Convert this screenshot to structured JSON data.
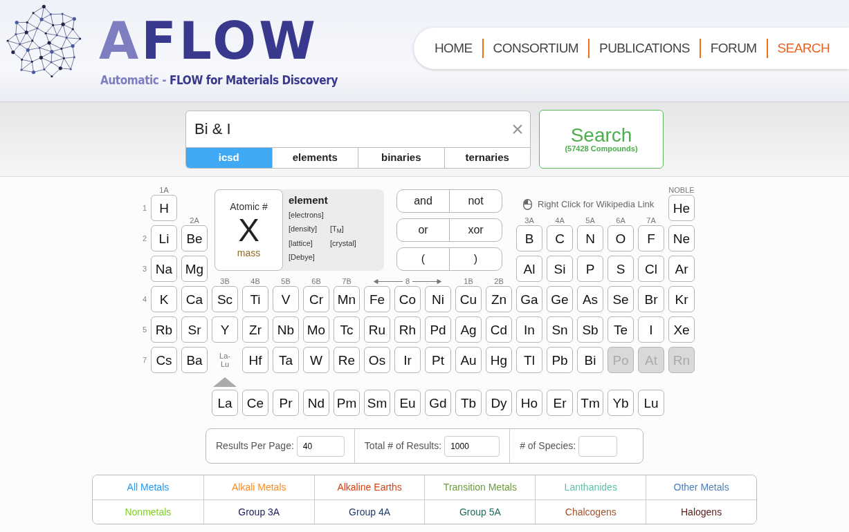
{
  "header": {
    "logo": "AFLOW",
    "tagline_prefix": "Automatic -",
    "tagline": "FLOW for Materials Discovery",
    "nav": [
      {
        "label": "HOME",
        "selected": false
      },
      {
        "label": "CONSORTIUM",
        "selected": false
      },
      {
        "label": "PUBLICATIONS",
        "selected": false
      },
      {
        "label": "FORUM",
        "selected": false
      },
      {
        "label": "SEARCH",
        "selected": true
      }
    ]
  },
  "search": {
    "value": "Bi & I",
    "tabs": [
      {
        "label": "icsd",
        "selected": true
      },
      {
        "label": "elements",
        "selected": false
      },
      {
        "label": "binaries",
        "selected": false
      },
      {
        "label": "ternaries",
        "selected": false
      }
    ],
    "button": "Search",
    "count": "(57428 Compounds)"
  },
  "legend": {
    "atomic_number": "Atomic #",
    "symbol": "X",
    "mass": "mass",
    "name": "element",
    "properties": [
      "[electrons]",
      "[density]",
      "[T$_{M}$]",
      "[lattice]",
      "[crystal]",
      "[Debye]"
    ]
  },
  "operators": [
    [
      "and",
      "not"
    ],
    [
      "or",
      "xor"
    ],
    [
      "(",
      ")"
    ]
  ],
  "hint": "Right Click for Wikipedia Link",
  "periods": [
    {
      "label": "1",
      "cells": [
        {
          "kind": "element",
          "symbol": "H",
          "group": "1A",
          "disabled": false
        },
        {
          "kind": "blank"
        },
        {
          "kind": "blank"
        },
        {
          "kind": "blank"
        },
        {
          "kind": "blank"
        },
        {
          "kind": "blank"
        },
        {
          "kind": "blank"
        },
        {
          "kind": "blank"
        },
        {
          "kind": "blank"
        },
        {
          "kind": "blank"
        },
        {
          "kind": "blank"
        },
        {
          "kind": "blank"
        },
        {
          "kind": "blank"
        },
        {
          "kind": "blank"
        },
        {
          "kind": "blank"
        },
        {
          "kind": "blank"
        },
        {
          "kind": "blank"
        },
        {
          "kind": "element",
          "symbol": "He",
          "group": "NOBLE",
          "disabled": false
        }
      ]
    },
    {
      "label": "2",
      "cells": [
        {
          "kind": "element",
          "symbol": "Li",
          "disabled": false
        },
        {
          "kind": "element",
          "symbol": "Be",
          "group": "2A",
          "disabled": false
        },
        {
          "kind": "blank"
        },
        {
          "kind": "blank"
        },
        {
          "kind": "blank"
        },
        {
          "kind": "blank"
        },
        {
          "kind": "blank"
        },
        {
          "kind": "blank"
        },
        {
          "kind": "blank"
        },
        {
          "kind": "blank"
        },
        {
          "kind": "blank"
        },
        {
          "kind": "blank"
        },
        {
          "kind": "element",
          "symbol": "B",
          "group": "3A",
          "disabled": false
        },
        {
          "kind": "element",
          "symbol": "C",
          "group": "4A",
          "disabled": false
        },
        {
          "kind": "element",
          "symbol": "N",
          "group": "5A",
          "disabled": false
        },
        {
          "kind": "element",
          "symbol": "O",
          "group": "6A",
          "disabled": false
        },
        {
          "kind": "element",
          "symbol": "F",
          "group": "7A",
          "disabled": false
        },
        {
          "kind": "element",
          "symbol": "Ne",
          "disabled": false
        }
      ]
    },
    {
      "label": "3",
      "cells": [
        {
          "kind": "element",
          "symbol": "Na",
          "disabled": false
        },
        {
          "kind": "element",
          "symbol": "Mg",
          "disabled": false
        },
        {
          "kind": "blank"
        },
        {
          "kind": "blank"
        },
        {
          "kind": "blank"
        },
        {
          "kind": "blank"
        },
        {
          "kind": "blank"
        },
        {
          "kind": "blank"
        },
        {
          "kind": "blank"
        },
        {
          "kind": "blank"
        },
        {
          "kind": "blank"
        },
        {
          "kind": "blank"
        },
        {
          "kind": "element",
          "symbol": "Al",
          "disabled": false
        },
        {
          "kind": "element",
          "symbol": "Si",
          "disabled": false
        },
        {
          "kind": "element",
          "symbol": "P",
          "disabled": false
        },
        {
          "kind": "element",
          "symbol": "S",
          "disabled": false
        },
        {
          "kind": "element",
          "symbol": "Cl",
          "disabled": false
        },
        {
          "kind": "element",
          "symbol": "Ar",
          "disabled": false
        }
      ]
    },
    {
      "label": "4",
      "cells": [
        {
          "kind": "element",
          "symbol": "K",
          "disabled": false
        },
        {
          "kind": "element",
          "symbol": "Ca",
          "disabled": false
        },
        {
          "kind": "element",
          "symbol": "Sc",
          "group": "3B",
          "disabled": false
        },
        {
          "kind": "element",
          "symbol": "Ti",
          "group": "4B",
          "disabled": false
        },
        {
          "kind": "element",
          "symbol": "V",
          "group": "5B",
          "disabled": false
        },
        {
          "kind": "element",
          "symbol": "Cr",
          "group": "6B",
          "disabled": false
        },
        {
          "kind": "element",
          "symbol": "Mn",
          "group": "7B",
          "disabled": false
        },
        {
          "kind": "element",
          "symbol": "Fe",
          "disabled": false
        },
        {
          "kind": "element",
          "symbol": "Co",
          "group": "8",
          "group_arrows": true,
          "disabled": false
        },
        {
          "kind": "element",
          "symbol": "Ni",
          "disabled": false
        },
        {
          "kind": "element",
          "symbol": "Cu",
          "group": "1B",
          "disabled": false
        },
        {
          "kind": "element",
          "symbol": "Zn",
          "group": "2B",
          "disabled": false
        },
        {
          "kind": "element",
          "symbol": "Ga",
          "disabled": false
        },
        {
          "kind": "element",
          "symbol": "Ge",
          "disabled": false
        },
        {
          "kind": "element",
          "symbol": "As",
          "disabled": false
        },
        {
          "kind": "element",
          "symbol": "Se",
          "disabled": false
        },
        {
          "kind": "element",
          "symbol": "Br",
          "disabled": false
        },
        {
          "kind": "element",
          "symbol": "Kr",
          "disabled": false
        }
      ]
    },
    {
      "label": "5",
      "cells": [
        {
          "kind": "element",
          "symbol": "Rb",
          "disabled": false
        },
        {
          "kind": "element",
          "symbol": "Sr",
          "disabled": false
        },
        {
          "kind": "element",
          "symbol": "Y",
          "disabled": false
        },
        {
          "kind": "element",
          "symbol": "Zr",
          "disabled": false
        },
        {
          "kind": "element",
          "symbol": "Nb",
          "disabled": false
        },
        {
          "kind": "element",
          "symbol": "Mo",
          "disabled": false
        },
        {
          "kind": "element",
          "symbol": "Tc",
          "disabled": false
        },
        {
          "kind": "element",
          "symbol": "Ru",
          "disabled": false
        },
        {
          "kind": "element",
          "symbol": "Rh",
          "disabled": false
        },
        {
          "kind": "element",
          "symbol": "Pd",
          "disabled": false
        },
        {
          "kind": "element",
          "symbol": "Ag",
          "disabled": false
        },
        {
          "kind": "element",
          "symbol": "Cd",
          "disabled": false
        },
        {
          "kind": "element",
          "symbol": "In",
          "disabled": false
        },
        {
          "kind": "element",
          "symbol": "Sn",
          "disabled": false
        },
        {
          "kind": "element",
          "symbol": "Sb",
          "disabled": false
        },
        {
          "kind": "element",
          "symbol": "Te",
          "disabled": false
        },
        {
          "kind": "element",
          "symbol": "I",
          "disabled": false
        },
        {
          "kind": "element",
          "symbol": "Xe",
          "disabled": false
        }
      ]
    },
    {
      "label": "7",
      "cells": [
        {
          "kind": "element",
          "symbol": "Cs",
          "disabled": false
        },
        {
          "kind": "element",
          "symbol": "Ba",
          "disabled": false
        },
        {
          "kind": "range",
          "symbol": "La-Lu"
        },
        {
          "kind": "element",
          "symbol": "Hf",
          "disabled": false
        },
        {
          "kind": "element",
          "symbol": "Ta",
          "disabled": false
        },
        {
          "kind": "element",
          "symbol": "W",
          "disabled": false
        },
        {
          "kind": "element",
          "symbol": "Re",
          "disabled": false
        },
        {
          "kind": "element",
          "symbol": "Os",
          "disabled": false
        },
        {
          "kind": "element",
          "symbol": "Ir",
          "disabled": false
        },
        {
          "kind": "element",
          "symbol": "Pt",
          "disabled": false
        },
        {
          "kind": "element",
          "symbol": "Au",
          "disabled": false
        },
        {
          "kind": "element",
          "symbol": "Hg",
          "disabled": false
        },
        {
          "kind": "element",
          "symbol": "Tl",
          "disabled": false
        },
        {
          "kind": "element",
          "symbol": "Pb",
          "disabled": false
        },
        {
          "kind": "element",
          "symbol": "Bi",
          "disabled": false
        },
        {
          "kind": "element",
          "symbol": "Po",
          "disabled": true
        },
        {
          "kind": "element",
          "symbol": "At",
          "disabled": true
        },
        {
          "kind": "element",
          "symbol": "Rn",
          "disabled": true
        }
      ]
    }
  ],
  "lanthanides": [
    {
      "kind": "blank"
    },
    {
      "kind": "blank"
    },
    {
      "kind": "element",
      "symbol": "La",
      "disabled": false
    },
    {
      "kind": "element",
      "symbol": "Ce",
      "disabled": false
    },
    {
      "kind": "element",
      "symbol": "Pr",
      "disabled": false
    },
    {
      "kind": "element",
      "symbol": "Nd",
      "disabled": false
    },
    {
      "kind": "element",
      "symbol": "Pm",
      "disabled": false
    },
    {
      "kind": "element",
      "symbol": "Sm",
      "disabled": false
    },
    {
      "kind": "element",
      "symbol": "Eu",
      "disabled": false
    },
    {
      "kind": "element",
      "symbol": "Gd",
      "disabled": false
    },
    {
      "kind": "element",
      "symbol": "Tb",
      "disabled": false
    },
    {
      "kind": "element",
      "symbol": "Dy",
      "disabled": false
    },
    {
      "kind": "element",
      "symbol": "Ho",
      "disabled": false
    },
    {
      "kind": "element",
      "symbol": "Er",
      "disabled": false
    },
    {
      "kind": "element",
      "symbol": "Tm",
      "disabled": false
    },
    {
      "kind": "element",
      "symbol": "Yb",
      "disabled": false
    },
    {
      "kind": "element",
      "symbol": "Lu",
      "disabled": false
    }
  ],
  "results": [
    {
      "label": "Results Per Page:",
      "value": "40"
    },
    {
      "label": "Total # of Results:",
      "value": "1000"
    },
    {
      "label": "# of Species:"
    }
  ],
  "categories": [
    {
      "label": "All Metals",
      "color": "#2196f3"
    },
    {
      "label": "Alkali Metals",
      "color": "#ff8c1a"
    },
    {
      "label": "Alkaline Earths",
      "color": "#dd3d0c"
    },
    {
      "label": "Transition Metals",
      "color": "#6b9a3c"
    },
    {
      "label": "Lanthanides",
      "color": "#5fbfa8"
    },
    {
      "label": "Other Metals",
      "color": "#4a7ebf"
    },
    {
      "label": "Nonmetals",
      "color": "#7ed321"
    },
    {
      "label": "Group 3A",
      "color": "#1a1a5e"
    },
    {
      "label": "Group 4A",
      "color": "#1f3a6a"
    },
    {
      "label": "Group 5A",
      "color": "#1f6a5a"
    },
    {
      "label": "Chalcogens",
      "color": "#a0522d"
    },
    {
      "label": "Halogens",
      "color": "#5a1a1a"
    }
  ]
}
